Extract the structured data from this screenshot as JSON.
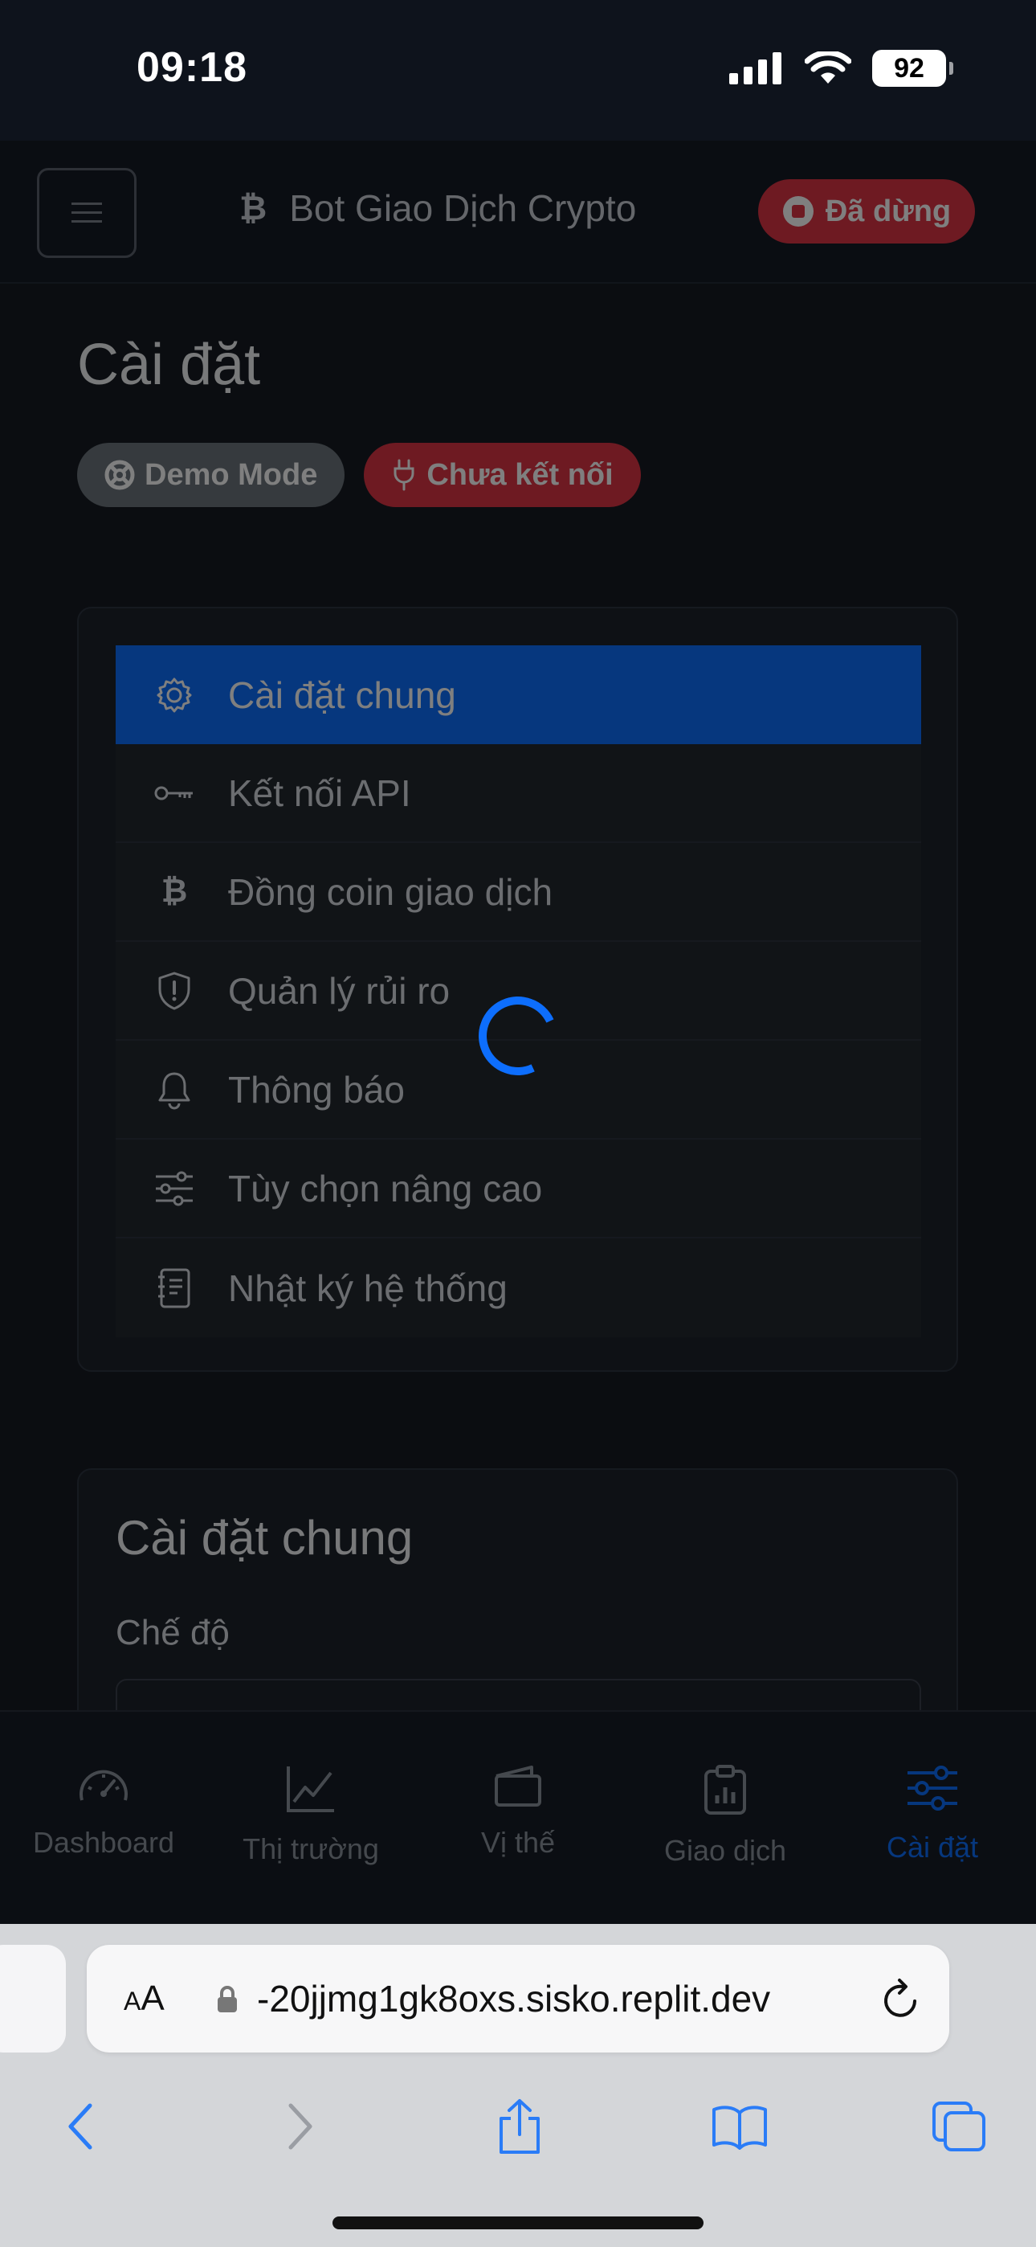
{
  "status_bar": {
    "time": "09:18",
    "battery": "92"
  },
  "header": {
    "brand_icon": "₿",
    "title": "Bot Giao Dịch Crypto",
    "status_pill": "Đã dừng"
  },
  "page": {
    "title": "Cài đặt",
    "badges": {
      "demo": "Demo Mode",
      "connection": "Chưa kết nối"
    }
  },
  "settings_nav": {
    "items": [
      {
        "label": "Cài đặt chung",
        "icon": "gear-icon",
        "active": true
      },
      {
        "label": "Kết nối API",
        "icon": "key-icon"
      },
      {
        "label": "Đồng coin giao dịch",
        "icon": "bitcoin-icon"
      },
      {
        "label": "Quản lý rủi ro",
        "icon": "shield-exclamation-icon"
      },
      {
        "label": "Thông báo",
        "icon": "bell-icon"
      },
      {
        "label": "Tùy chọn nâng cao",
        "icon": "sliders-icon"
      },
      {
        "label": "Nhật ký hệ thống",
        "icon": "journal-text-icon"
      }
    ]
  },
  "general_settings": {
    "title": "Cài đặt chung",
    "mode_label": "Chế độ"
  },
  "tabbar": {
    "items": [
      {
        "label": "Dashboard",
        "icon": "speedometer-icon"
      },
      {
        "label": "Thị trường",
        "icon": "graph-up-icon"
      },
      {
        "label": "Vị thế",
        "icon": "wallet-icon"
      },
      {
        "label": "Giao dịch",
        "icon": "clipboard-data-icon"
      },
      {
        "label": "Cài đặt",
        "icon": "sliders-icon",
        "active": true
      }
    ]
  },
  "browser": {
    "aa": "AA",
    "url": "-20jjmg1gk8oxs.sisko.replit.dev"
  },
  "colors": {
    "primary": "#0d6efd",
    "danger": "#dc3545",
    "secondary": "#6c757d"
  }
}
